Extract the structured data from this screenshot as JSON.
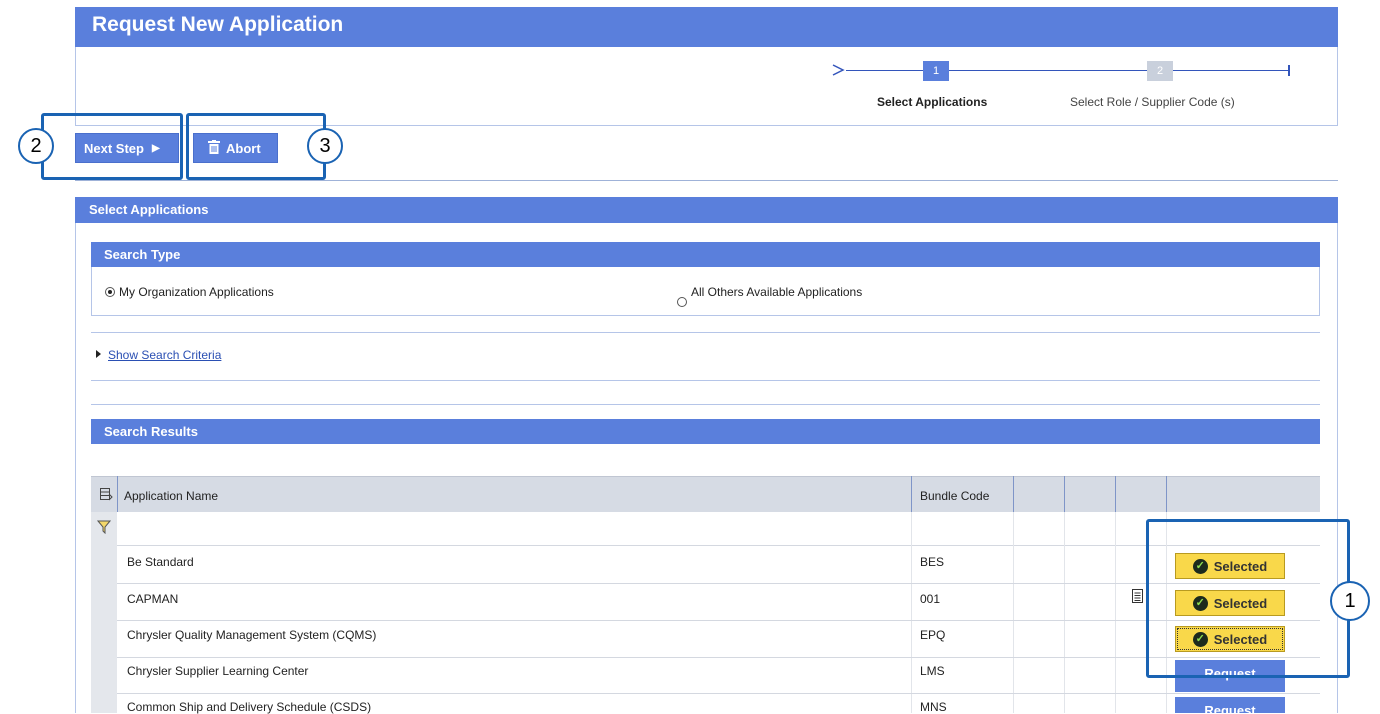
{
  "page": {
    "title": "Request New Application"
  },
  "wizard": {
    "steps": [
      {
        "number": "1",
        "label": "Select Applications"
      },
      {
        "number": "2",
        "label": "Select Role / Supplier Code (s)"
      }
    ]
  },
  "toolbar": {
    "next_label": "Next Step",
    "next_arrow": "▶",
    "abort_label": "Abort"
  },
  "callouts": {
    "one": "1",
    "two": "2",
    "three": "3"
  },
  "select_section": {
    "title": "Select Applications",
    "search_type": {
      "title": "Search Type",
      "options": [
        {
          "label": "My Organization Applications",
          "selected": true
        },
        {
          "label": "All Others Available Applications",
          "selected": false
        }
      ]
    },
    "show_criteria": "Show Search Criteria",
    "results_title": "Search Results"
  },
  "table": {
    "headers": {
      "app_name": "Application Name",
      "bundle_code": "Bundle Code"
    },
    "rows": [
      {
        "name": "Be Standard",
        "code": "BES",
        "action": "Selected"
      },
      {
        "name": "CAPMAN",
        "code": "001",
        "action": "Selected"
      },
      {
        "name": "Chrysler Quality Management System (CQMS)",
        "code": "EPQ",
        "action": "Selected"
      },
      {
        "name": "Chrysler Supplier Learning Center",
        "code": "LMS",
        "action": "Request"
      },
      {
        "name": "Common Ship and Delivery Schedule (CSDS)",
        "code": "MNS",
        "action": "Request"
      }
    ]
  },
  "colors": {
    "primary": "#5a7fdc",
    "callout": "#1a63b3",
    "selected": "#f9d84a"
  }
}
